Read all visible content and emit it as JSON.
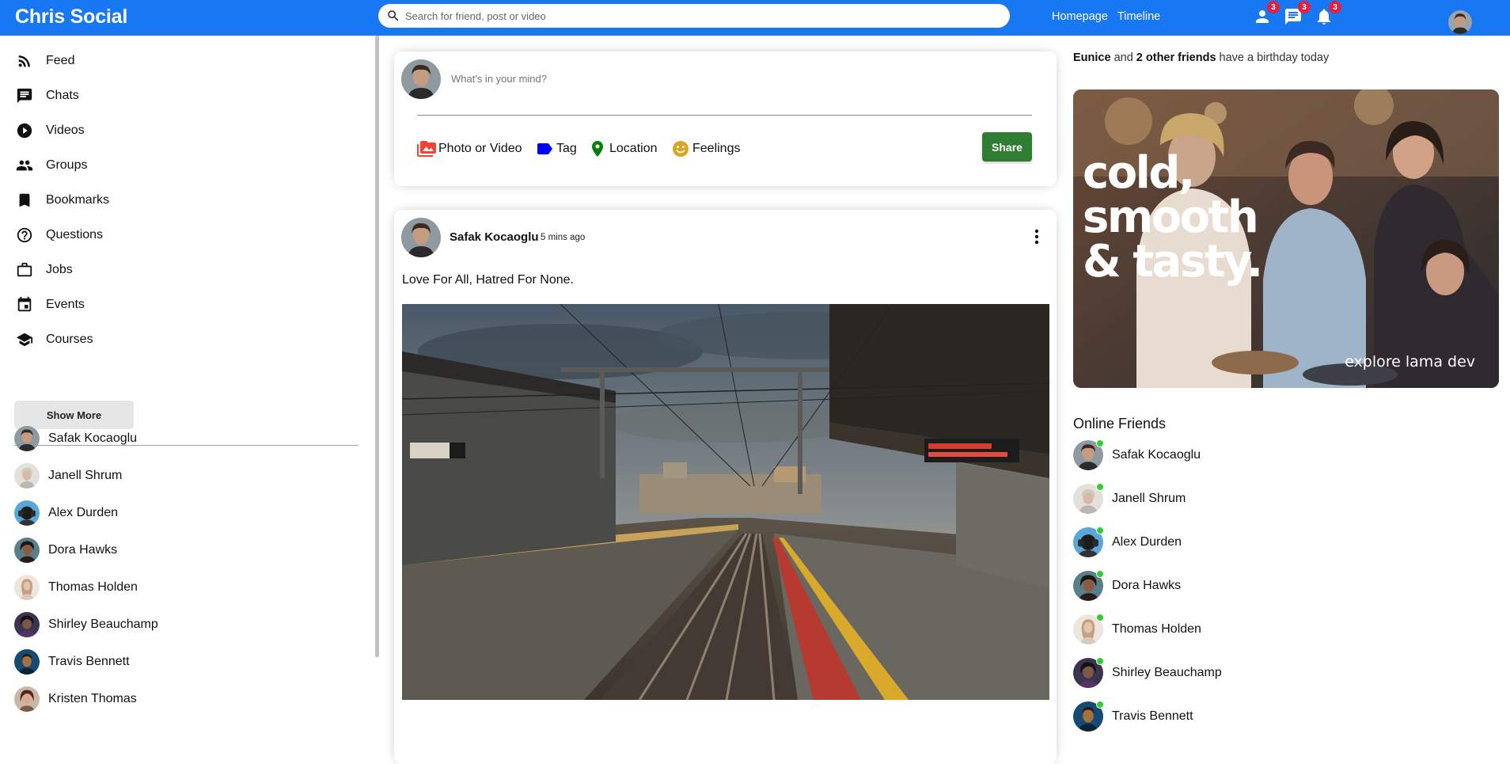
{
  "topbar": {
    "logo": "Chris Social",
    "search_placeholder": "Search for friend, post or video",
    "links": [
      "Homepage",
      "Timeline"
    ],
    "icons": [
      {
        "name": "person-icon",
        "badge": "3"
      },
      {
        "name": "chat-icon",
        "badge": "3"
      },
      {
        "name": "notifications-icon",
        "badge": "3"
      }
    ]
  },
  "sidebar": {
    "menu": [
      {
        "label": "Feed",
        "icon": "rss-feed-icon"
      },
      {
        "label": "Chats",
        "icon": "chat-icon"
      },
      {
        "label": "Videos",
        "icon": "play-circle-icon"
      },
      {
        "label": "Groups",
        "icon": "group-icon"
      },
      {
        "label": "Bookmarks",
        "icon": "bookmark-icon"
      },
      {
        "label": "Questions",
        "icon": "help-circle-icon"
      },
      {
        "label": "Jobs",
        "icon": "work-outline-icon"
      },
      {
        "label": "Events",
        "icon": "event-icon"
      },
      {
        "label": "Courses",
        "icon": "school-icon"
      }
    ],
    "show_more": "Show More",
    "friends": [
      "Safak Kocaoglu",
      "Janell Shrum",
      "Alex Durden",
      "Dora Hawks",
      "Thomas Holden",
      "Shirley Beauchamp",
      "Travis Bennett",
      "Kristen Thomas"
    ]
  },
  "share": {
    "placeholder": "What's in your mind?",
    "options": [
      {
        "label": "Photo or Video",
        "icon": "perm-media-icon",
        "color": "#f44336"
      },
      {
        "label": "Tag",
        "icon": "label-icon",
        "color": "#0000ff"
      },
      {
        "label": "Location",
        "icon": "room-icon",
        "color": "#008000"
      },
      {
        "label": "Feelings",
        "icon": "emoji-emotions-icon",
        "color": "#daa520"
      }
    ],
    "button": "Share"
  },
  "post": {
    "username": "Safak Kocaoglu",
    "time": "5 mins ago",
    "text": "Love For All, Hatred For None."
  },
  "rightbar": {
    "birthday": {
      "name": "Eunice",
      "middle": " and ",
      "others": "2 other friends",
      "tail": " have a birthday today"
    },
    "ad": {
      "line1": "cold,",
      "line2": "smooth",
      "line3": "& tasty.",
      "sub": "explore lama dev"
    },
    "online_title": "Online Friends",
    "online": [
      "Safak Kocaoglu",
      "Janell Shrum",
      "Alex Durden",
      "Dora Hawks",
      "Thomas Holden",
      "Shirley Beauchamp",
      "Travis Bennett"
    ]
  },
  "colors": {
    "topbar": "#1877f2",
    "badge": "#e41e3f",
    "share_button": "#2e7d32",
    "online_dot": "#32cd32"
  }
}
